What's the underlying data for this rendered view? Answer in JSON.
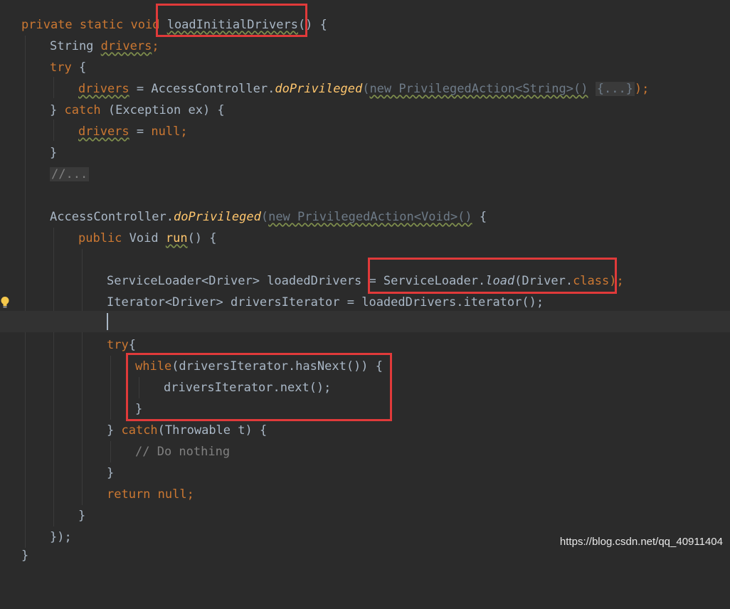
{
  "editor": {
    "lines": [
      {
        "p1": "private static void ",
        "fn": "loadInitialDrivers",
        "p2": "() {"
      },
      {
        "p1": "String ",
        "v": "drivers",
        "p2": ";"
      },
      {
        "kw": "try",
        "p2": " {"
      },
      {
        "v": "drivers",
        "p1": " = AccessController.",
        "m": "doPrivileged",
        "p2": "(",
        "n": "new PrivilegedAction<String>()",
        "fold": "{...}",
        "p3": ");"
      },
      {
        "p1": "} ",
        "kw": "catch",
        "p2": " (Exception ex) {"
      },
      {
        "v": "drivers",
        "p1": " = ",
        "kw": "null",
        "p2": ";"
      },
      {
        "p1": "}"
      },
      {
        "cmt": "//..."
      },
      {
        "p1": ""
      },
      {
        "p1": "AccessController.",
        "m": "doPrivileged",
        "p2": "(",
        "n": "new PrivilegedAction<Void>()",
        "p3": " {"
      },
      {
        "kw": "public",
        "p1": " Void ",
        "fn": "run",
        "p2": "() {"
      },
      {
        "p1": ""
      },
      {
        "p1": "ServiceLoader<Driver> loadedDrivers = ServiceLoader.",
        "m": "load",
        "p2": "(Driver.",
        "kw": "class",
        "p3": ");"
      },
      {
        "p1": "Iterator<Driver> driversIterator = loadedDrivers.iterator();"
      },
      {
        "p1": ""
      },
      {
        "kw": "try",
        "p2": "{"
      },
      {
        "kw": "while",
        "p2": "(driversIterator.hasNext()) {"
      },
      {
        "p1": "driversIterator.next();"
      },
      {
        "p1": "}"
      },
      {
        "p1": "} ",
        "kw": "catch",
        "p2": "(Throwable t) {"
      },
      {
        "cmt": "// Do nothing"
      },
      {
        "p1": "}"
      },
      {
        "kw": "return",
        "p1": " ",
        "kw2": "null",
        "p2": ";"
      },
      {
        "p1": "}"
      },
      {
        "p1": "});"
      },
      {
        "p1": "}"
      }
    ]
  },
  "watermark": "https://blog.csdn.net/qq_40911404",
  "colors": {
    "background": "#2b2b2b",
    "keyword": "#cc7832",
    "plain": "#a9b7c6",
    "method": "#ffc66d",
    "comment": "#808080",
    "highlight_box": "#e03a3a"
  },
  "icons": {
    "gutter": "lightbulb-icon"
  }
}
